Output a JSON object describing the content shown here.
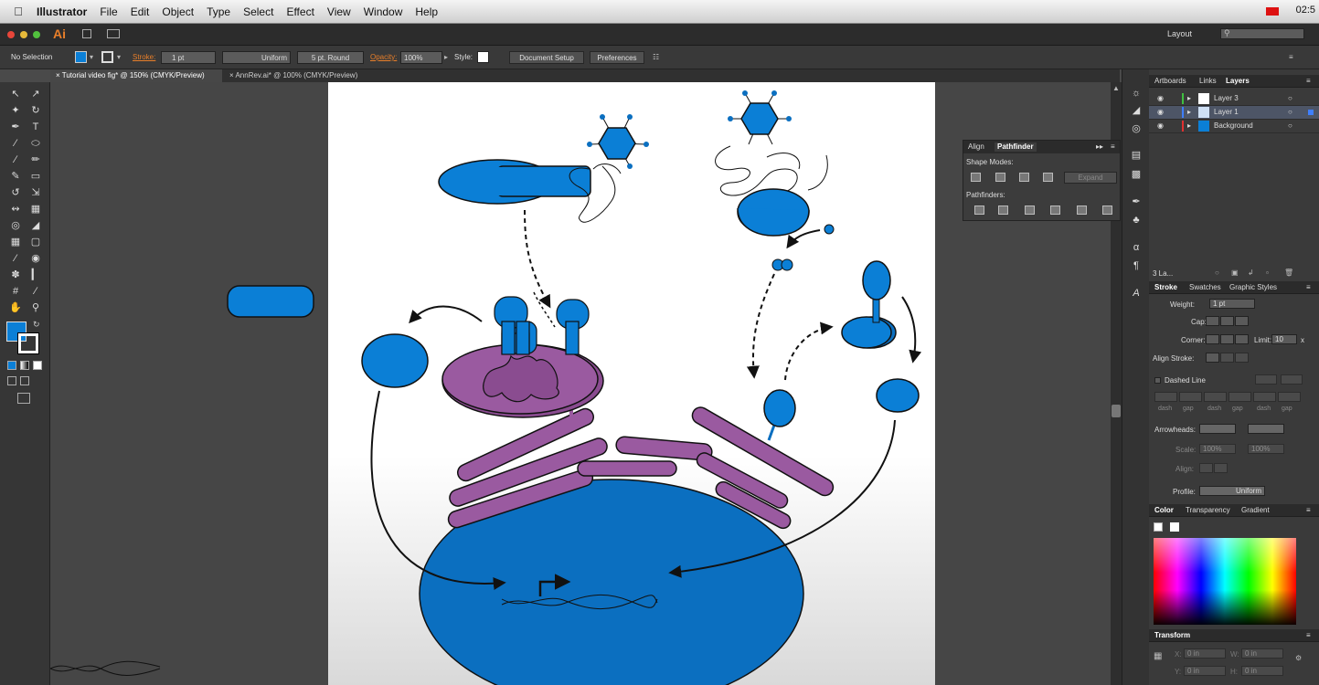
{
  "menubar": {
    "app_name": "Illustrator",
    "menus": [
      "File",
      "Edit",
      "Object",
      "Type",
      "Select",
      "Effect",
      "View",
      "Window",
      "Help"
    ],
    "clock": "02:5"
  },
  "appbar": {
    "logo": "Ai",
    "workspace": "Layout",
    "search_placeholder": ""
  },
  "control": {
    "selection": "No Selection",
    "stroke_label": "Stroke:",
    "stroke_value": "1 pt",
    "profile_value": "Uniform",
    "brush_value": "5 pt. Round",
    "opacity_label": "Opacity:",
    "opacity_value": "100%",
    "style_label": "Style:",
    "doc_setup": "Document Setup",
    "preferences": "Preferences"
  },
  "tabs": [
    {
      "label": "Tutorial video fig* @ 150% (CMYK/Preview)",
      "active": true
    },
    {
      "label": "AnnRev.ai* @ 100% (CMYK/Preview)",
      "active": false
    }
  ],
  "layers_panel": {
    "tabs": [
      "Artboards",
      "Links",
      "Layers"
    ],
    "active_tab": "Layers",
    "layers": [
      {
        "name": "Layer 3",
        "color": "#3fbf3f"
      },
      {
        "name": "Layer 1",
        "color": "#3f7fff",
        "selected": true
      },
      {
        "name": "Background",
        "color": "#e03030"
      }
    ],
    "footer": "3 La..."
  },
  "stroke_panel": {
    "tabs": [
      "Stroke",
      "Swatches",
      "Graphic Styles"
    ],
    "weight_label": "Weight:",
    "weight_value": "1 pt",
    "cap_label": "Cap:",
    "corner_label": "Corner:",
    "limit_label": "Limit:",
    "limit_value": "10",
    "limit_unit": "x",
    "align_label": "Align Stroke:",
    "dashed_label": "Dashed Line",
    "dash_labels": [
      "dash",
      "gap",
      "dash",
      "gap",
      "dash",
      "gap"
    ],
    "arrowheads_label": "Arrowheads:",
    "scale_label": "Scale:",
    "scale_values": [
      "100%",
      "100%"
    ],
    "align2_label": "Align:",
    "profile_label": "Profile:",
    "profile_value": "Uniform"
  },
  "color_panel": {
    "tabs": [
      "Color",
      "Transparency",
      "Gradient"
    ]
  },
  "transform_panel": {
    "title": "Transform",
    "labels": [
      "X:",
      "W:",
      "Y:",
      "H:"
    ],
    "values": [
      "0 in",
      "0 in",
      "0 in",
      "0 in"
    ]
  },
  "pathfinder_panel": {
    "tabs": [
      "Align",
      "Pathfinder"
    ],
    "active_tab": "Pathfinder",
    "shape_modes_label": "Shape Modes:",
    "expand_label": "Expand",
    "pathfinders_label": "Pathfinders:"
  },
  "colors": {
    "cell_blue": "#0b7fd6",
    "mito_purple": "#9a5aa0",
    "nucleus_blue": "#0b6fc0",
    "accent_orange": "#e87f2a"
  }
}
